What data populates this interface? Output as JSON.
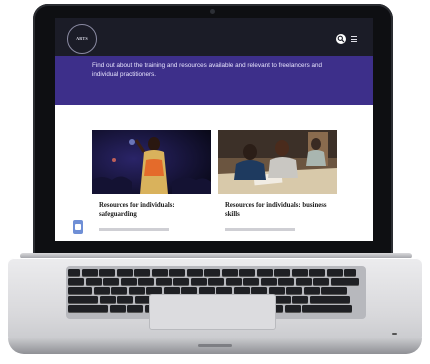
{
  "site": {
    "logo_text": "Arts Council England",
    "intro": "Find out about the training and resources available and relevant to freelancers and individual practitioners."
  },
  "cards": [
    {
      "title": "Resources for individuals: safeguarding"
    },
    {
      "title": "Resources for individuals: business skills"
    }
  ],
  "icons": {
    "search": "search-icon",
    "menu": "menu-icon"
  },
  "colors": {
    "hero_background": "#3d2f8a",
    "header_background": "#1b1c27"
  }
}
